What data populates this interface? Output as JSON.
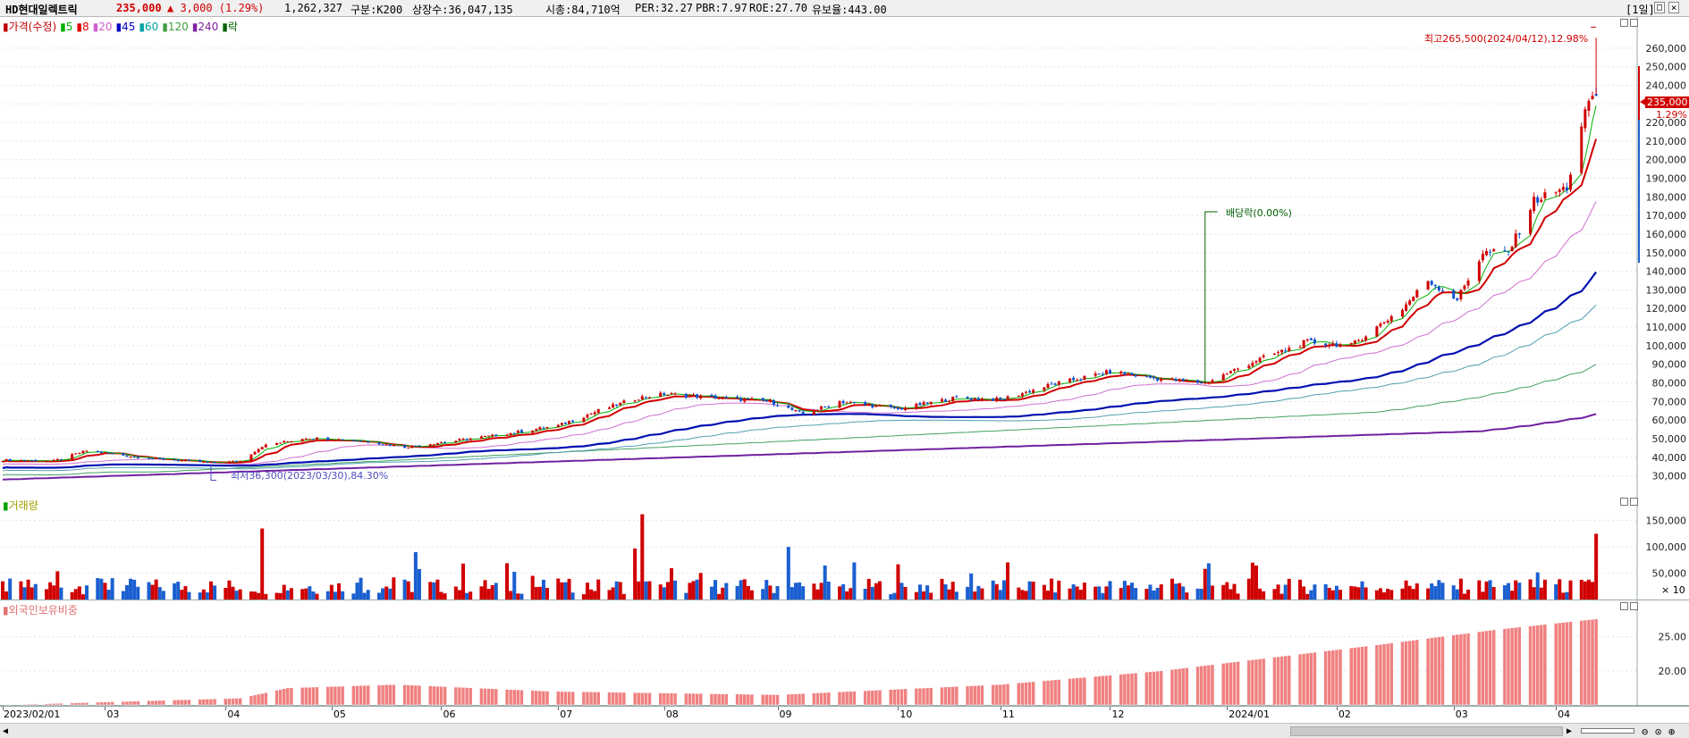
{
  "header": {
    "name": "HD현대일렉트릭",
    "price": "235,000",
    "change": "▲ 3,000 (1.29%)",
    "volume": "1,262,327",
    "group": "구분:K200",
    "shares": "상장수:36,047,135",
    "mcap": "시총:84,710억",
    "per": "PER:32.27",
    "pbr": "PBR:7.97",
    "roe": "ROE:27.70",
    "float": "유보율:443.00",
    "period": "[1일]",
    "win_btns": [
      "|",
      "□",
      "×"
    ]
  },
  "price_panel": {
    "legend": [
      {
        "label": "가격(수정)",
        "color": "#c00000"
      },
      {
        "label": "5",
        "color": "#00b000"
      },
      {
        "label": "8",
        "color": "#e00000"
      },
      {
        "label": "20",
        "color": "#d060d0"
      },
      {
        "label": "45",
        "color": "#0000c0"
      },
      {
        "label": "60",
        "color": "#00a0a0"
      },
      {
        "label": "120",
        "color": "#40a040"
      },
      {
        "label": "240",
        "color": "#8020a0"
      },
      {
        "label": "락",
        "color": "#006000"
      }
    ],
    "high_label": "최고265,500(2024/04/12),12.98%",
    "low_label": "최저36,300(2023/03/30),84.30%",
    "ex_div_label": "배당락(0.00%)",
    "current_price_tag": "235,000",
    "current_pct_tag": "1.29%"
  },
  "volume_panel": {
    "legend": "거래량",
    "unit": "× 10"
  },
  "foreign_panel": {
    "legend": "외국인보유비중"
  },
  "x_axis_labels": [
    "2023/02/01",
    "03",
    "04",
    "05",
    "06",
    "07",
    "08",
    "09",
    "10",
    "11",
    "12",
    "2024/01",
    "02",
    "03",
    "04"
  ],
  "chart_data": [
    {
      "type": "candlestick",
      "title": "HD현대일렉트릭 가격(수정)",
      "ylim": [
        25000,
        270000
      ],
      "y_ticks": [
        30000,
        40000,
        50000,
        60000,
        70000,
        80000,
        90000,
        100000,
        110000,
        120000,
        130000,
        140000,
        150000,
        160000,
        170000,
        180000,
        190000,
        200000,
        210000,
        220000,
        230000,
        240000,
        250000,
        260000
      ],
      "x_range": [
        "2023/02/01",
        "2024/04/15"
      ],
      "close_path": [
        {
          "x": "2023/02/01",
          "y": 38500
        },
        {
          "x": "2023/02/15",
          "y": 38000
        },
        {
          "x": "2023/02/24",
          "y": 43500
        },
        {
          "x": "2023/03/10",
          "y": 40000
        },
        {
          "x": "2023/03/30",
          "y": 37000
        },
        {
          "x": "2023/04/07",
          "y": 38000
        },
        {
          "x": "2023/04/13",
          "y": 46000
        },
        {
          "x": "2023/04/25",
          "y": 50500
        },
        {
          "x": "2023/05/10",
          "y": 49000
        },
        {
          "x": "2023/05/22",
          "y": 45500
        },
        {
          "x": "2023/06/01",
          "y": 48000
        },
        {
          "x": "2023/06/15",
          "y": 51500
        },
        {
          "x": "2023/07/03",
          "y": 57000
        },
        {
          "x": "2023/07/14",
          "y": 65000
        },
        {
          "x": "2023/07/25",
          "y": 72000
        },
        {
          "x": "2023/08/01",
          "y": 74000
        },
        {
          "x": "2023/08/16",
          "y": 72000
        },
        {
          "x": "2023/08/30",
          "y": 70000
        },
        {
          "x": "2023/09/08",
          "y": 63000
        },
        {
          "x": "2023/09/18",
          "y": 70000
        },
        {
          "x": "2023/10/04",
          "y": 66000
        },
        {
          "x": "2023/10/20",
          "y": 72000
        },
        {
          "x": "2023/11/01",
          "y": 71000
        },
        {
          "x": "2023/11/15",
          "y": 79000
        },
        {
          "x": "2023/12/01",
          "y": 86000
        },
        {
          "x": "2023/12/15",
          "y": 82000
        },
        {
          "x": "2023/12/27",
          "y": 80000
        },
        {
          "x": "2024/01/10",
          "y": 92000
        },
        {
          "x": "2024/01/24",
          "y": 102000
        },
        {
          "x": "2024/02/05",
          "y": 100000
        },
        {
          "x": "2024/02/19",
          "y": 120000
        },
        {
          "x": "2024/02/26",
          "y": 135000
        },
        {
          "x": "2024/03/05",
          "y": 125000
        },
        {
          "x": "2024/03/12",
          "y": 150000
        },
        {
          "x": "2024/03/19",
          "y": 150000
        },
        {
          "x": "2024/03/26",
          "y": 178000
        },
        {
          "x": "2024/04/04",
          "y": 185000
        },
        {
          "x": "2024/04/10",
          "y": 232000
        },
        {
          "x": "2024/04/12",
          "y": 235000
        }
      ],
      "high": 265500,
      "low": 36300,
      "last_close": 235000
    },
    {
      "type": "bar",
      "title": "거래량",
      "ylim": [
        0,
        180000
      ],
      "y_ticks": [
        50000,
        100000,
        150000
      ],
      "unit_multiplier": 10,
      "notable_bars": [
        {
          "x": "2023/04/13",
          "y": 135000
        },
        {
          "x": "2023/05/25",
          "y": 90000
        },
        {
          "x": "2023/07/26",
          "y": 162000
        },
        {
          "x": "2023/07/24",
          "y": 97000
        },
        {
          "x": "2023/09/04",
          "y": 100000
        },
        {
          "x": "2024/04/12",
          "y": 125000
        }
      ],
      "typical_range": [
        10000,
        40000
      ]
    },
    {
      "type": "bar",
      "title": "외국인보유비중",
      "ylim": [
        15,
        29
      ],
      "y_ticks": [
        20.0,
        25.0
      ],
      "path": [
        {
          "x": "2023/02/01",
          "y": 15.0
        },
        {
          "x": "2023/04/07",
          "y": 16.0
        },
        {
          "x": "2023/04/20",
          "y": 17.5
        },
        {
          "x": "2023/05/20",
          "y": 18.0
        },
        {
          "x": "2023/07/01",
          "y": 17.0
        },
        {
          "x": "2023/09/01",
          "y": 16.5
        },
        {
          "x": "2023/11/01",
          "y": 18.0
        },
        {
          "x": "2023/12/15",
          "y": 20.0
        },
        {
          "x": "2024/01/15",
          "y": 22.0
        },
        {
          "x": "2024/02/15",
          "y": 24.0
        },
        {
          "x": "2024/03/15",
          "y": 26.0
        },
        {
          "x": "2024/04/12",
          "y": 27.6
        }
      ]
    }
  ]
}
